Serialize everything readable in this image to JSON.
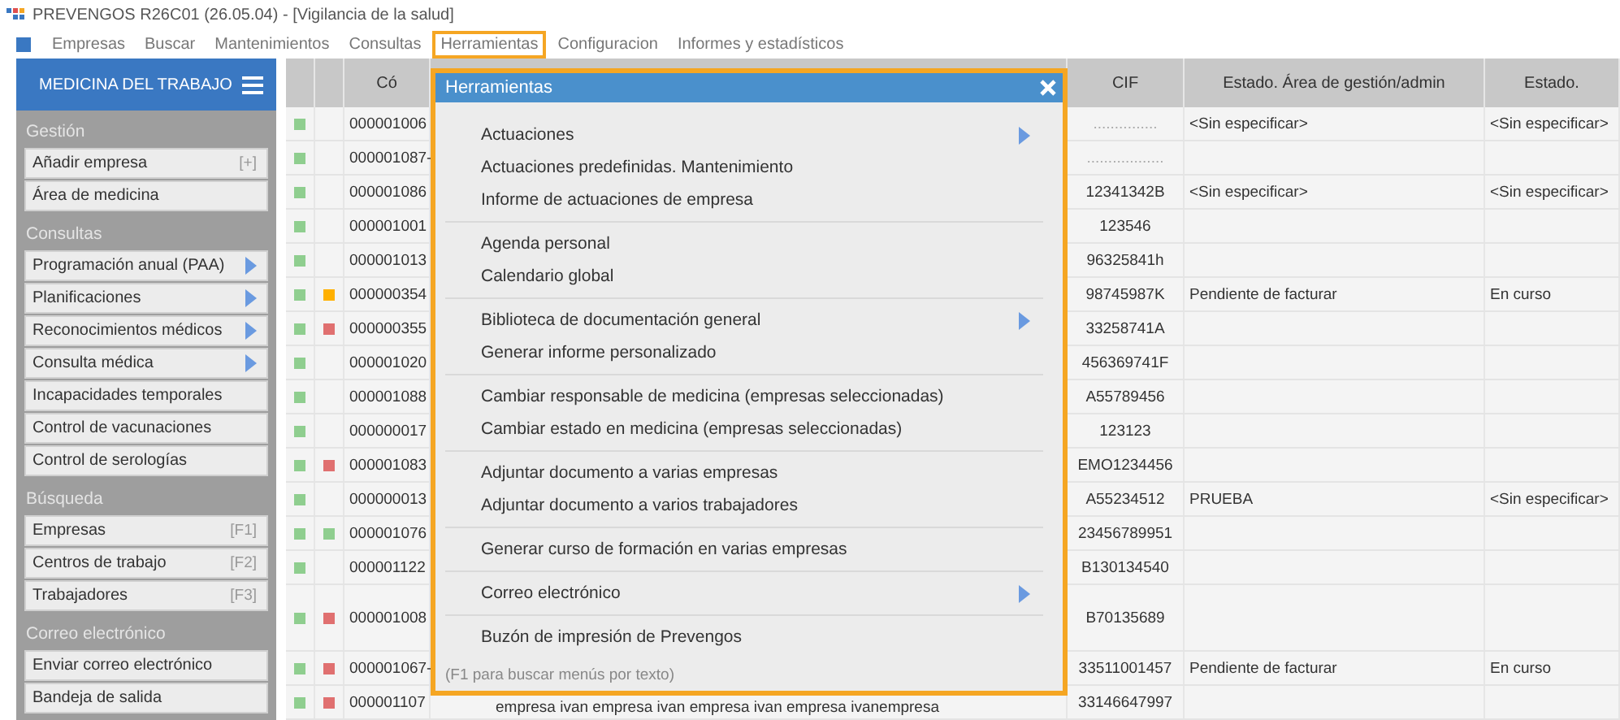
{
  "window": {
    "title": "PREVENGOS R26C01 (26.05.04) - [Vigilancia de la salud]"
  },
  "menubar": [
    {
      "label": "Empresas",
      "selected": false
    },
    {
      "label": "Buscar",
      "selected": false
    },
    {
      "label": "Mantenimientos",
      "selected": false
    },
    {
      "label": "Consultas",
      "selected": false
    },
    {
      "label": "Herramientas",
      "selected": true
    },
    {
      "label": "Configuracion",
      "selected": false
    },
    {
      "label": "Informes y estadísticos",
      "selected": false
    }
  ],
  "sidebar": {
    "title": "MEDICINA DEL TRABAJO",
    "sections": [
      {
        "title": "Gestión",
        "items": [
          {
            "label": "Añadir empresa",
            "kind": "shortcut",
            "shortcut": "[+]"
          },
          {
            "label": "Área de medicina",
            "kind": "plain"
          }
        ]
      },
      {
        "title": "Consultas",
        "items": [
          {
            "label": "Programación anual (PAA)",
            "kind": "submenu"
          },
          {
            "label": "Planificaciones",
            "kind": "submenu"
          },
          {
            "label": "Reconocimientos médicos",
            "kind": "submenu"
          },
          {
            "label": "Consulta médica",
            "kind": "submenu"
          },
          {
            "label": "Incapacidades temporales",
            "kind": "plain"
          },
          {
            "label": "Control de vacunaciones",
            "kind": "plain"
          },
          {
            "label": "Control de serologías",
            "kind": "plain"
          }
        ]
      },
      {
        "title": "Búsqueda",
        "items": [
          {
            "label": "Empresas",
            "kind": "shortcut",
            "shortcut": "[F1]"
          },
          {
            "label": "Centros de trabajo",
            "kind": "shortcut",
            "shortcut": "[F2]"
          },
          {
            "label": "Trabajadores",
            "kind": "shortcut",
            "shortcut": "[F3]"
          }
        ]
      },
      {
        "title": "Correo electrónico",
        "items": [
          {
            "label": "Enviar correo electrónico",
            "kind": "plain"
          },
          {
            "label": "Bandeja de salida",
            "kind": "plain"
          }
        ]
      }
    ]
  },
  "table": {
    "columns": [
      "Có",
      "CIF",
      "Estado. Área de gestión/admin",
      "Estado."
    ],
    "rows": [
      {
        "color": "#8fce8f",
        "flag": null,
        "code": "000001006",
        "cif": "...............",
        "estado_gestion": "<Sin especificar>",
        "estado": "<Sin especificar>",
        "tall": false
      },
      {
        "color": "#8fce8f",
        "flag": null,
        "code": "000001087-",
        "cif": "..................",
        "estado_gestion": "",
        "estado": "",
        "tall": false
      },
      {
        "color": "#8fce8f",
        "flag": null,
        "code": "000001086",
        "cif": "12341342B",
        "estado_gestion": "<Sin especificar>",
        "estado": "<Sin especificar>",
        "tall": false
      },
      {
        "color": "#8fce8f",
        "flag": null,
        "code": "000001001",
        "cif": "123546",
        "estado_gestion": "",
        "estado": "",
        "tall": false
      },
      {
        "color": "#8fce8f",
        "flag": null,
        "code": "000001013",
        "cif": "96325841h",
        "estado_gestion": "",
        "estado": "",
        "tall": false
      },
      {
        "color": "#8fce8f",
        "flag": {
          "color": "#ffb000"
        },
        "code": "000000354",
        "cif": "98745987K",
        "estado_gestion": "Pendiente de facturar",
        "estado": "En curso",
        "tall": false
      },
      {
        "color": "#8fce8f",
        "flag": {
          "color": "#e07070"
        },
        "code": "000000355",
        "cif": "33258741A",
        "estado_gestion": "",
        "estado": "",
        "tall": false
      },
      {
        "color": "#8fce8f",
        "flag": null,
        "code": "000001020",
        "cif": "456369741F",
        "estado_gestion": "",
        "estado": "",
        "tall": false
      },
      {
        "color": "#8fce8f",
        "flag": null,
        "code": "000001088",
        "cif": "A55789456",
        "estado_gestion": "",
        "estado": "",
        "tall": false
      },
      {
        "color": "#8fce8f",
        "flag": null,
        "code": "000000017",
        "cif": "123123",
        "estado_gestion": "",
        "estado": "",
        "tall": false
      },
      {
        "color": "#8fce8f",
        "flag": {
          "color": "#e07070"
        },
        "code": "000001083",
        "cif": "EMO1234456",
        "estado_gestion": "",
        "estado": "",
        "tall": false
      },
      {
        "color": "#8fce8f",
        "flag": null,
        "code": "000000013",
        "cif": "A55234512",
        "estado_gestion": "PRUEBA",
        "estado": "<Sin especificar>",
        "tall": false
      },
      {
        "color": "#8fce8f",
        "flag": {
          "color": "#8fce8f"
        },
        "code": "000001076",
        "cif": "23456789951",
        "estado_gestion": "",
        "estado": "",
        "tall": false
      },
      {
        "color": "#8fce8f",
        "flag": null,
        "code": "000001122",
        "cif": "B130134540",
        "estado_gestion": "",
        "estado": "",
        "tall": false
      },
      {
        "color": "#8fce8f",
        "flag": {
          "color": "#e07070"
        },
        "code": "000001008",
        "cif": "B70135689",
        "estado_gestion": "",
        "estado": "",
        "tall": true
      },
      {
        "color": "#8fce8f",
        "flag": {
          "color": "#e07070"
        },
        "code": "000001067-",
        "cif": "33511001457",
        "estado_gestion": "Pendiente de facturar",
        "estado": "En curso",
        "tall": false
      },
      {
        "color": "#8fce8f",
        "flag": {
          "color": "#e07070"
        },
        "code": "000001107",
        "cif": "33146647997",
        "estado_gestion": "",
        "estado": "",
        "tall": false
      }
    ]
  },
  "menu": {
    "title": "Herramientas",
    "groups": [
      [
        {
          "label": "Actuaciones",
          "submenu": true
        },
        {
          "label": "Actuaciones predefinidas. Mantenimiento",
          "submenu": false
        },
        {
          "label": "Informe de actuaciones de empresa",
          "submenu": false
        }
      ],
      [
        {
          "label": "Agenda personal",
          "submenu": false
        },
        {
          "label": "Calendario global",
          "submenu": false
        }
      ],
      [
        {
          "label": "Biblioteca de documentación general",
          "submenu": true
        },
        {
          "label": "Generar informe personalizado",
          "submenu": false
        }
      ],
      [
        {
          "label": "Cambiar responsable de medicina (empresas seleccionadas)",
          "submenu": false
        },
        {
          "label": "Cambiar estado en medicina (empresas seleccionadas)",
          "submenu": false
        }
      ],
      [
        {
          "label": "Adjuntar documento a varias empresas",
          "submenu": false
        },
        {
          "label": "Adjuntar documento a varios trabajadores",
          "submenu": false
        }
      ],
      [
        {
          "label": "Generar curso de formación en varias empresas",
          "submenu": false
        }
      ],
      [
        {
          "label": "Correo electrónico",
          "submenu": true
        }
      ],
      [
        {
          "label": "Buzón de impresión de Prevengos",
          "submenu": false
        }
      ]
    ],
    "hint": "(F1 para buscar menús por texto)"
  },
  "below_text": "empresa ivan empresa ivan empresa ivan empresa ivanempresa"
}
